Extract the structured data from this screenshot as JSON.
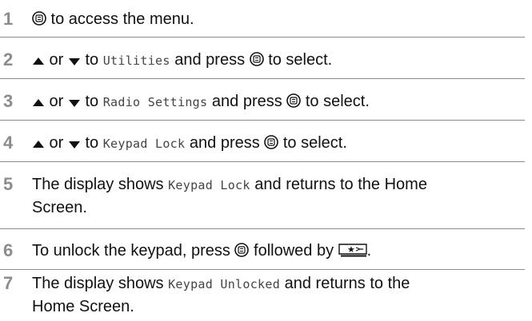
{
  "steps": [
    {
      "number": "1",
      "pre": "",
      "post": " to access the menu."
    },
    {
      "number": "2",
      "pre": " or ",
      "mid1": " to ",
      "code": "Utilities",
      "mid2": " and press ",
      "post": " to select."
    },
    {
      "number": "3",
      "pre": " or ",
      "mid1": " to ",
      "code": "Radio Settings",
      "mid2": " and press ",
      "post": " to select."
    },
    {
      "number": "4",
      "pre": " or ",
      "mid1": " to ",
      "code": "Keypad Lock",
      "mid2": " and press ",
      "post": " to select."
    },
    {
      "number": "5",
      "line1_pre": "The display shows ",
      "code": "Keypad Lock",
      "line1_post": " and returns to the Home",
      "line2": "Screen."
    },
    {
      "number": "6",
      "pre": "To unlock the keypad, press ",
      "mid": " followed by ",
      "post": "."
    },
    {
      "number": "7",
      "line1_pre": "The display shows ",
      "code": "Keypad Unlocked",
      "line1_post": " and returns to the",
      "line2": "Home Screen."
    }
  ],
  "icons": {
    "menu_button": "menu-ok-button-icon",
    "up": "up-arrow-icon",
    "down": "down-arrow-icon",
    "star_key": "star-key-icon"
  }
}
